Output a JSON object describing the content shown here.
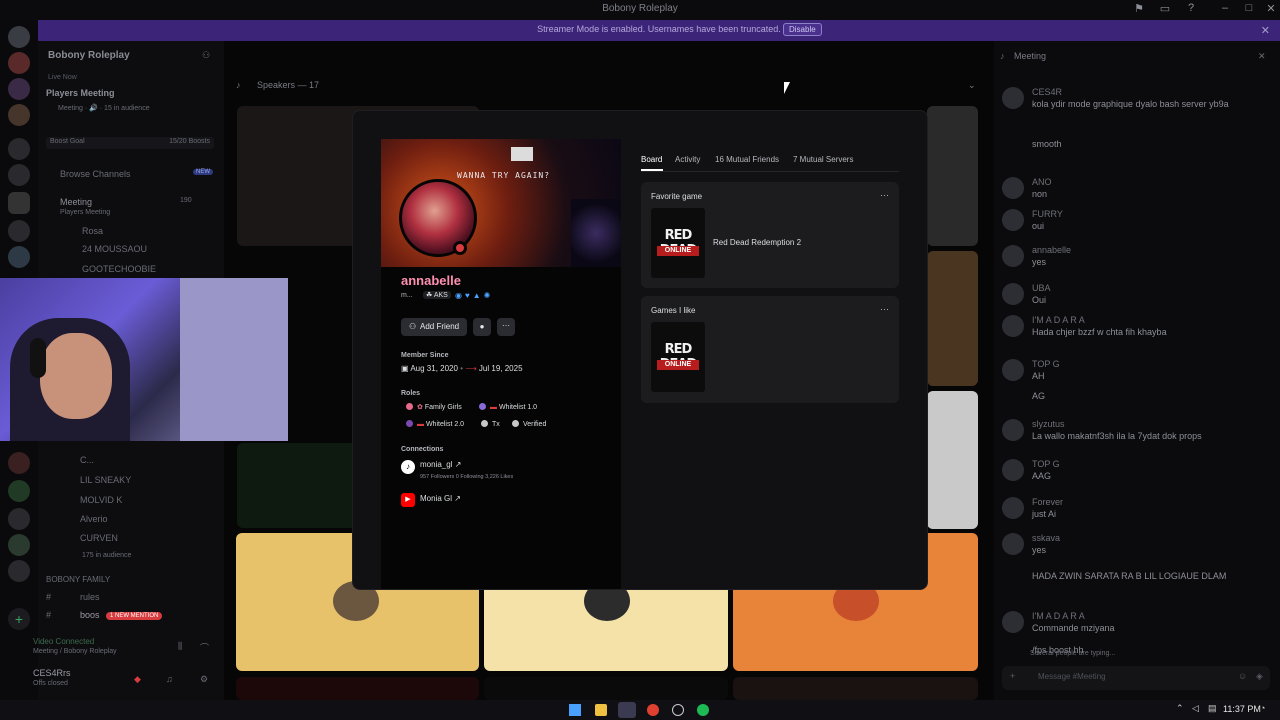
{
  "window": {
    "title": "Bobony Roleplay"
  },
  "banner_bar": {
    "message": "Streamer Mode is enabled. Usernames have been truncated.",
    "disable_label": "Disable"
  },
  "server": {
    "name": "Bobony Roleplay"
  },
  "sidebar": {
    "live_event_badge": "Live Now",
    "event_title": "Players Meeting",
    "event_sub": "Meeting · 🔊 · 15 in audience",
    "boost_goal_label": "Boost Goal",
    "boost_count": "15/20 Boosts",
    "browse_channels": "Browse Channels",
    "new_badge": "NEW",
    "meeting_channel": "Meeting",
    "meeting_sub": "Players Meeting",
    "meeting_count": "190",
    "users": [
      "Rosa",
      "24 MOUSSAOU",
      "GOOTECHOOBIE"
    ],
    "lower_users": [
      "C...",
      "LIL SNEAKY",
      "MOLVID K",
      "Alverio",
      "CURVEN"
    ],
    "audience": "175 in audience",
    "category": "BOBONY FAMILY",
    "channels": [
      "rules",
      "boos"
    ],
    "mention_badge": "1 NEW MENTION",
    "voice_status": "Video Connected",
    "voice_location": "Meeting / Bobony Roleplay",
    "username": "CES4Rrs",
    "user_status": "Offs closed"
  },
  "voice": {
    "speakers_label": "Speakers — 17"
  },
  "profile": {
    "banner_text": "WANNA TRY AGAIN?",
    "display_name": "annabelle",
    "username_short": "m...",
    "guild_tag": "AKS",
    "add_friend_label": "Add Friend",
    "member_since_label": "Member Since",
    "member_since_discord": "Aug 31, 2020",
    "member_since_server": "Jul 19, 2025",
    "roles_label": "Roles",
    "roles": [
      {
        "name": "Family Girls",
        "color": "#e86a8a"
      },
      {
        "name": "Whitelist 1.0",
        "color": "#8a6ad8"
      },
      {
        "name": "Whitelist 2.0",
        "color": "#7a4ab0"
      },
      {
        "name": "Tx",
        "color": "#c8c8c8"
      },
      {
        "name": "Verified",
        "color": "#c8c8c8"
      }
    ],
    "connections_label": "Connections",
    "connections": [
      {
        "name": "monia_gl ↗",
        "stats": "957 Followers  0 Following  3,226 Likes",
        "icon": "tiktok-icon"
      },
      {
        "name": "Monia Gl ↗",
        "stats": "",
        "icon": "youtube-icon"
      }
    ]
  },
  "tabs": [
    "Board",
    "Activity",
    "16 Mutual Friends",
    "7 Mutual Servers"
  ],
  "cards": {
    "favorite_title": "Favorite game",
    "favorite_game": "Red Dead Redemption 2",
    "liked_title": "Games I like",
    "art_line1": "RED DEAD",
    "art_line2": "ONLINE"
  },
  "chat": {
    "channel": "Meeting",
    "messages": [
      {
        "name": "CES4R",
        "text": "kola ydir mode graphique dyalo bash server yb9a"
      },
      {
        "name": "",
        "text": "smooth"
      },
      {
        "name": "ANO",
        "text": "non"
      },
      {
        "name": "FURRY",
        "text": "oui"
      },
      {
        "name": "annabelle",
        "text": "yes"
      },
      {
        "name": "UBA",
        "text": "Oui"
      },
      {
        "name": "I'M A D A R A",
        "text": "Hada chjer bzzf w chta fih khayba"
      },
      {
        "name": "TOP G",
        "text": "AH"
      },
      {
        "name": "",
        "text": "AG"
      },
      {
        "name": "slyzutus",
        "text": "La wallo makatnf3sh ila la 7ydat dok props"
      },
      {
        "name": "TOP G",
        "text": "AAG"
      },
      {
        "name": "Forever",
        "text": "just Ai"
      },
      {
        "name": "sskava",
        "text": "yes"
      },
      {
        "name": "",
        "text": "HADA ZWIN SARATA RA B LIL LOGIAUE DLAM"
      },
      {
        "name": "I'M A D A R A",
        "text": "Commande mziyana"
      },
      {
        "name": "",
        "text": "/fps boost hh"
      }
    ],
    "typing": "Several people are typing...",
    "input_placeholder": "Message #Meeting"
  },
  "taskbar": {
    "time": "11:37 PM"
  },
  "colors": {
    "accent": "#5865f2",
    "banner_purple": "#3c2578",
    "name_pink": "#ff8fb0"
  }
}
